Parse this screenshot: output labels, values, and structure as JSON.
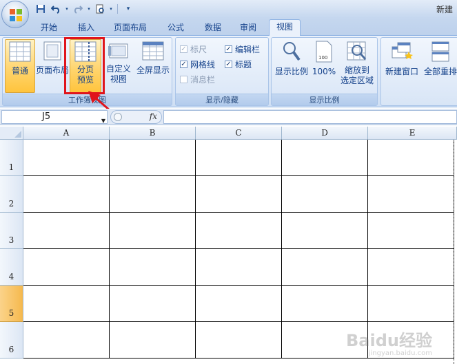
{
  "titlebar": {
    "title": "新建",
    "qat": [
      "save-icon",
      "undo-icon",
      "redo-icon",
      "print-preview-icon",
      "customize-icon"
    ]
  },
  "tabs": [
    {
      "label": "开始"
    },
    {
      "label": "插入"
    },
    {
      "label": "页面布局"
    },
    {
      "label": "公式"
    },
    {
      "label": "数据"
    },
    {
      "label": "审阅"
    },
    {
      "label": "视图",
      "active": true
    }
  ],
  "ribbon": {
    "workbook_views": {
      "label": "工作簿视图",
      "normal": "普通",
      "page_layout": "页面布局",
      "page_break_1": "分页",
      "page_break_2": "预览",
      "custom_1": "自定义",
      "custom_2": "视图",
      "full_screen": "全屏显示"
    },
    "show_hide": {
      "label": "显示/隐藏",
      "ruler": "标尺",
      "formula_bar": "编辑栏",
      "gridlines": "网格线",
      "headings": "标题",
      "message_bar": "消息栏"
    },
    "zoom": {
      "label": "显示比例",
      "zoom": "显示比例",
      "pct100": "100%",
      "zoom_sel_1": "缩放到",
      "zoom_sel_2": "选定区域"
    },
    "window": {
      "new_window": "新建窗口",
      "arrange_all": "全部重排"
    }
  },
  "formula_bar": {
    "name_box": "J5",
    "fx": "fx",
    "value": ""
  },
  "sheet": {
    "columns": [
      "A",
      "B",
      "C",
      "D",
      "E"
    ],
    "rows": [
      "1",
      "2",
      "3",
      "4",
      "5",
      "6"
    ],
    "active_row": "5"
  },
  "watermark": {
    "text": "Baidu经验",
    "sub": "jingyan.baidu.com"
  },
  "colors": {
    "highlight": "#e0141b",
    "accent": "#15428b"
  }
}
